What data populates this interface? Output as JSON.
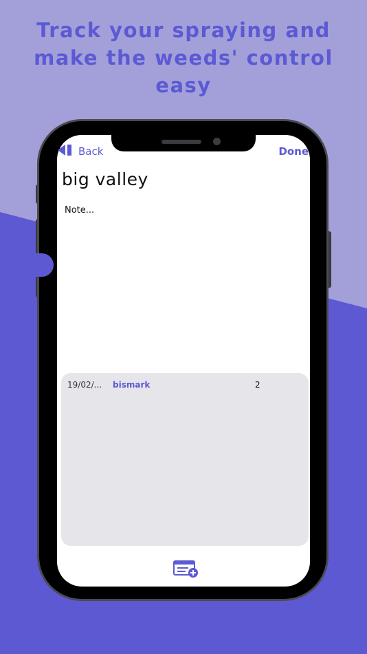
{
  "headline": "Track your spraying  and\nmake the weeds' control\neasy",
  "nav": {
    "back_label": "Back",
    "done_label": "Done"
  },
  "page": {
    "title": "big valley",
    "note_placeholder": "Note..."
  },
  "records": [
    {
      "date": "19/02/...",
      "name": "bismark",
      "count": "2"
    }
  ],
  "icons": {
    "back": "back-chevron-icon",
    "add_record": "add-record-icon"
  },
  "colors": {
    "accent": "#5c59d4",
    "background_light": "#a3a0d9",
    "background_dark": "#5d59d3",
    "list_background": "#e5e5ea"
  }
}
